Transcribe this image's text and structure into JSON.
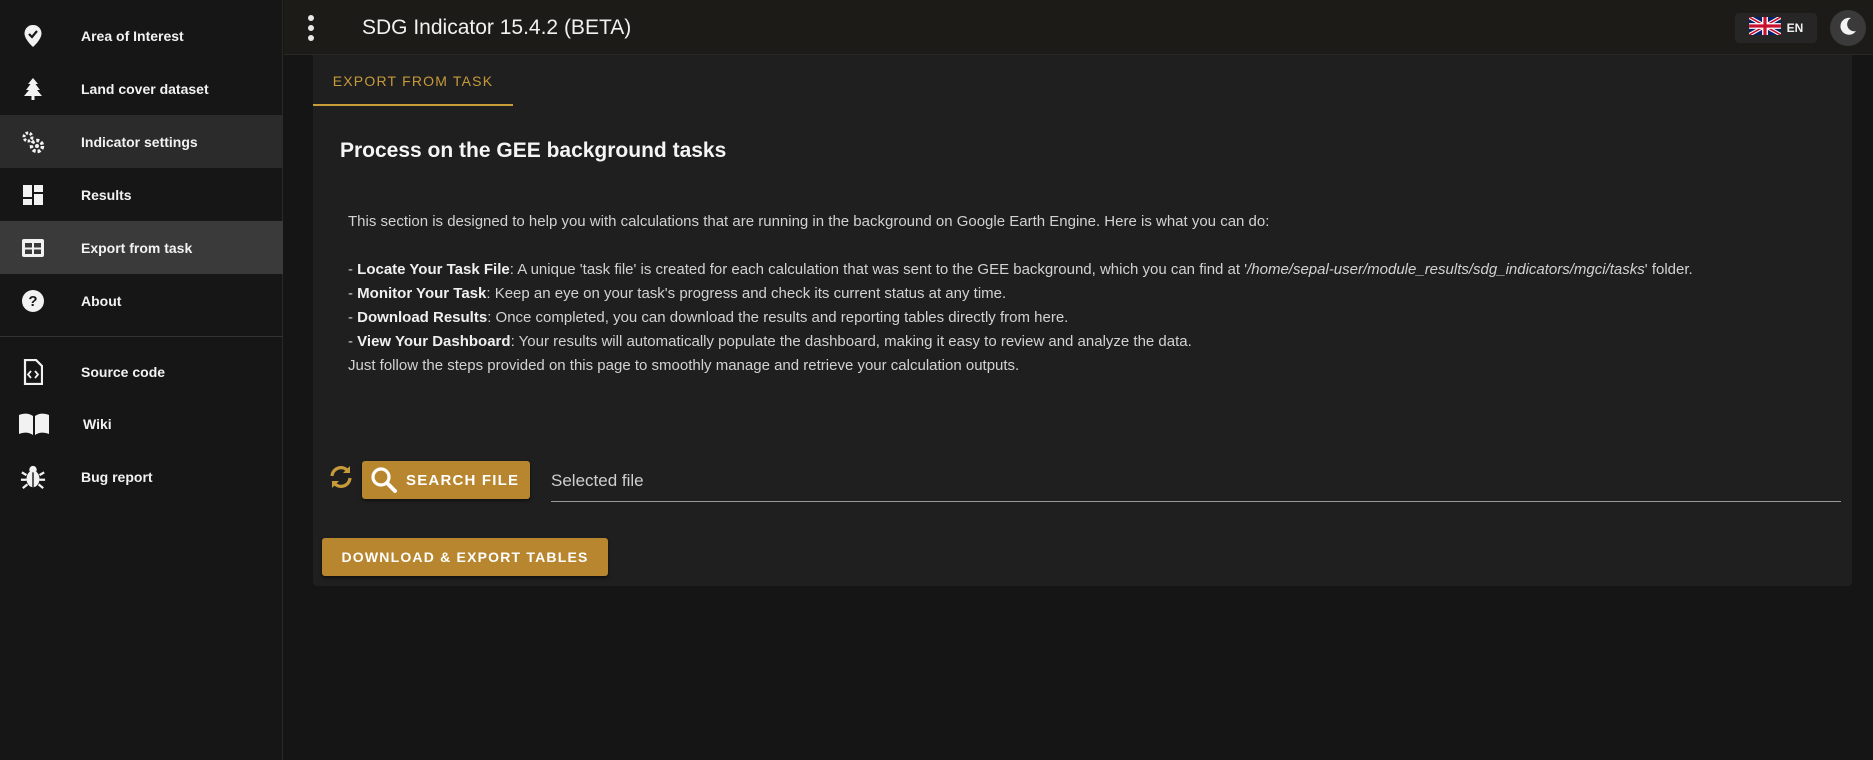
{
  "sidebar": {
    "items": [
      {
        "label": "Area of Interest",
        "icon": "map-marker-check-icon"
      },
      {
        "label": "Land cover dataset",
        "icon": "pine-tree-icon"
      },
      {
        "label": "Indicator settings",
        "icon": "gears-icon"
      },
      {
        "label": "Results",
        "icon": "dashboard-icon"
      },
      {
        "label": "Export from task",
        "icon": "table-icon"
      },
      {
        "label": "About",
        "icon": "question-circle-icon"
      }
    ],
    "links": [
      {
        "label": "Source code",
        "icon": "file-code-icon"
      },
      {
        "label": "Wiki",
        "icon": "book-icon"
      },
      {
        "label": "Bug report",
        "icon": "bug-icon"
      }
    ]
  },
  "header": {
    "title": "SDG Indicator 15.4.2 (BETA)",
    "language": "EN"
  },
  "main": {
    "tab_label": "EXPORT FROM TASK",
    "section_title": "Process on the GEE background tasks",
    "intro": "This section is designed to help you with calculations that are running in the background on Google Earth Engine. Here is what you can do:",
    "bullets": [
      {
        "prefix": "- ",
        "bold": "Locate Your Task File",
        "text": ": A unique 'task file' is created for each calculation that was sent to the GEE background, which you can find at '",
        "italic": "/home/sepal-user/module_results/sdg_indicators/mgci/tasks",
        "suffix": "' folder."
      },
      {
        "prefix": "- ",
        "bold": "Monitor Your Task",
        "text": ": Keep an eye on your task's progress and check its current status at any time."
      },
      {
        "prefix": "- ",
        "bold": "Download Results",
        "text": ": Once completed, you can download the results and reporting tables directly from here."
      },
      {
        "prefix": "- ",
        "bold": "View Your Dashboard",
        "text": ": Your results will automatically populate the dashboard, making it easy to review and analyze the data."
      }
    ],
    "outro": "Just follow the steps provided on this page to smoothly manage and retrieve your calculation outputs.",
    "search_button": "SEARCH FILE",
    "file_placeholder": "Selected file",
    "download_button": "DOWNLOAD & EXPORT TABLES"
  },
  "colors": {
    "accent": "#b8862e",
    "tab_accent": "#c79a3a",
    "background": "#151515",
    "card": "#1f1f1f"
  }
}
